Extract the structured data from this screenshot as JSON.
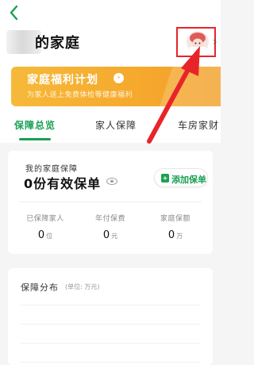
{
  "header": {
    "title": "的家庭",
    "back_icon": "chevron-left-icon",
    "more_icon": "chevron-right-icon",
    "accent_color": "#1aa053"
  },
  "banner": {
    "title": "家庭福利计划",
    "subtitle": "为家人送上免费体检等健康福利",
    "color": "#f5a92d"
  },
  "tabs": [
    {
      "label": "保障总览",
      "active": true
    },
    {
      "label": "家人保障",
      "active": false
    },
    {
      "label": "车房家财",
      "active": false
    }
  ],
  "summary": {
    "label": "我的家庭保障",
    "policy_count": "0份有效保单",
    "add_button": "添加保单",
    "stats": [
      {
        "label": "已保障家人",
        "value": "0",
        "unit": "位"
      },
      {
        "label": "年付保费",
        "value": "0",
        "unit": "元"
      },
      {
        "label": "家庭保额",
        "value": "0",
        "unit": "万"
      }
    ]
  },
  "distribution": {
    "title": "保障分布",
    "unit": "(单位: 万元)"
  },
  "annotation": {
    "highlight_color": "#e8242b"
  }
}
